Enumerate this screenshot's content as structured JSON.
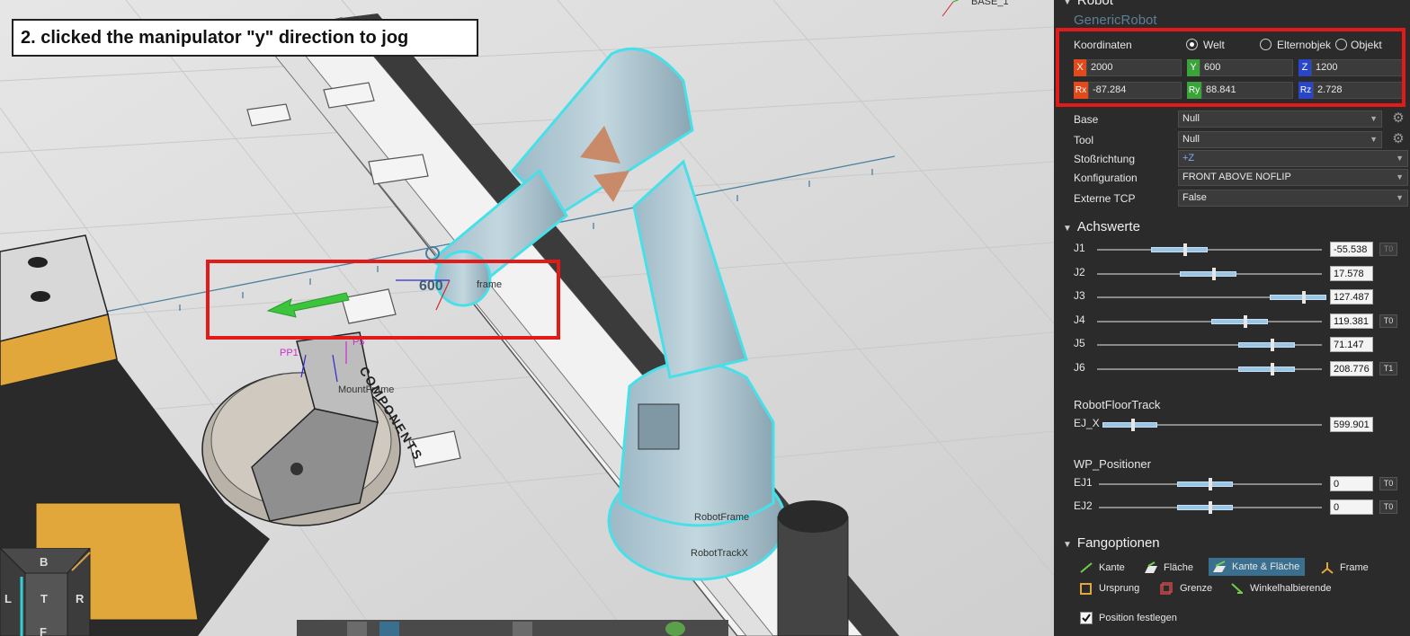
{
  "caption": "2. clicked the manipulator \"y\" direction to jog",
  "viewport": {
    "labels": {
      "base_frame": "BASE_1",
      "manip_value": "600",
      "robot_frame_fragment": "frame",
      "pp1": "PP1",
      "p5": "P5",
      "mount_frame": "MountFrame",
      "robot_frame": "RobotFrame",
      "robot_track": "RobotTrackX",
      "track_logo": "COMPONENTS"
    },
    "view_cube": {
      "top": "B",
      "left": "L",
      "center": "T",
      "right": "R",
      "bottom": "F"
    },
    "colors": {
      "manip_arrow": "#3cc43c",
      "robot_highlight": "#48e0e8",
      "highlight_box": "#e21a1a"
    }
  },
  "panel": {
    "header_title": "Robot",
    "robot_name": "GenericRobot",
    "coords": {
      "label": "Koordinaten",
      "options": [
        {
          "label": "Welt",
          "selected": true
        },
        {
          "label": "Elternobjek",
          "selected": false
        },
        {
          "label": "Objekt",
          "selected": false
        }
      ],
      "fields": [
        {
          "tag": "X",
          "value": "2000",
          "color": "#e24a1c"
        },
        {
          "tag": "Y",
          "value": "600",
          "color": "#3aa33a"
        },
        {
          "tag": "Z",
          "value": "1200",
          "color": "#2a46c8"
        },
        {
          "tag": "Rx",
          "value": "-87.284",
          "color": "#e24a1c"
        },
        {
          "tag": "Ry",
          "value": "88.841",
          "color": "#3aa33a"
        },
        {
          "tag": "Rz",
          "value": "2.728",
          "color": "#2a46c8"
        }
      ]
    },
    "props": [
      {
        "label": "Base",
        "value": "Null",
        "gear": true
      },
      {
        "label": "Tool",
        "value": "Null",
        "gear": true
      },
      {
        "label": "Stoßrichtung",
        "value": "+Z",
        "gear": false
      },
      {
        "label": "Konfiguration",
        "value": "FRONT ABOVE NOFLIP",
        "gear": false
      },
      {
        "label": "Externe TCP",
        "value": "False",
        "gear": false
      }
    ],
    "achswerte": {
      "title": "Achswerte",
      "joints": [
        {
          "name": "J1",
          "value": "-55.538",
          "badge": "T0",
          "badge_dim": true,
          "fraction": 0.39
        },
        {
          "name": "J2",
          "value": "17.578",
          "badge": "",
          "badge_dim": false,
          "fraction": 0.52
        },
        {
          "name": "J3",
          "value": "127.487",
          "badge": "",
          "badge_dim": false,
          "fraction": 0.92
        },
        {
          "name": "J4",
          "value": "119.381",
          "badge": "T0",
          "badge_dim": false,
          "fraction": 0.66
        },
        {
          "name": "J5",
          "value": "71.147",
          "badge": "",
          "badge_dim": false,
          "fraction": 0.78
        },
        {
          "name": "J6",
          "value": "208.776",
          "badge": "T1",
          "badge_dim": false,
          "fraction": 0.78
        }
      ]
    },
    "floor_track": {
      "title": "RobotFloorTrack",
      "joints": [
        {
          "name": "EJ_X",
          "value": "599.901",
          "badge": "",
          "fraction": 0.14
        }
      ]
    },
    "positioner": {
      "title": "WP_Positioner",
      "joints": [
        {
          "name": "EJ1",
          "value": "0",
          "badge": "T0",
          "fraction": 0.5
        },
        {
          "name": "EJ2",
          "value": "0",
          "badge": "T0",
          "fraction": 0.5
        }
      ]
    },
    "fangoptionen": {
      "title": "Fangoptionen",
      "row1": [
        {
          "label": "Kante",
          "icon": "edge-icon",
          "active": false
        },
        {
          "label": "Fläche",
          "icon": "face-icon",
          "active": false
        },
        {
          "label": "Kante & Fläche",
          "icon": "edge-face-icon",
          "active": true
        },
        {
          "label": "Frame",
          "icon": "frame-icon",
          "active": false
        }
      ],
      "row2": [
        {
          "label": "Ursprung",
          "icon": "origin-icon",
          "active": false
        },
        {
          "label": "Grenze",
          "icon": "bounds-icon",
          "active": false
        },
        {
          "label": "Winkelhalbierende",
          "icon": "bisector-icon",
          "active": false
        }
      ]
    },
    "fix_position": {
      "label": "Position festlegen",
      "checked": true
    }
  }
}
